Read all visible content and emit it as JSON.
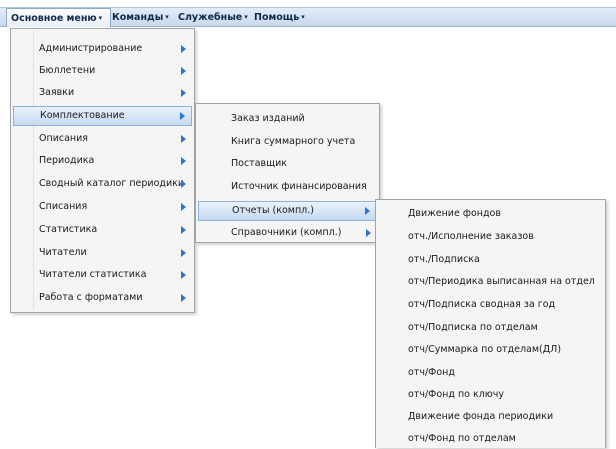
{
  "menubar": {
    "items": [
      {
        "label": "Основное меню"
      },
      {
        "label": "Команды"
      },
      {
        "label": "Служебные"
      },
      {
        "label": "Помощь"
      }
    ],
    "arrow": "▾"
  },
  "main_menu": {
    "items": [
      {
        "label": "Администрирование"
      },
      {
        "label": "Бюллетени"
      },
      {
        "label": "Заявки"
      },
      {
        "label": "Комплектование"
      },
      {
        "label": "Описания"
      },
      {
        "label": "Периодика"
      },
      {
        "label": "Сводный каталог периодики"
      },
      {
        "label": "Списания"
      },
      {
        "label": "Статистика"
      },
      {
        "label": "Читатели"
      },
      {
        "label": "Читатели статистика"
      },
      {
        "label": "Работа с форматами"
      }
    ]
  },
  "komplekt_menu": {
    "items": [
      {
        "label": "Заказ изданий"
      },
      {
        "label": "Книга суммарного учета"
      },
      {
        "label": "Поставщик"
      },
      {
        "label": "Источник финансирования"
      },
      {
        "label": "Отчеты (компл.)"
      },
      {
        "label": "Справочники (компл.)"
      }
    ]
  },
  "reports_menu": {
    "items": [
      {
        "label": "Движение фондов"
      },
      {
        "label": "отч./Исполнение заказов"
      },
      {
        "label": "отч./Подписка"
      },
      {
        "label": "отч/Периодика выписанная на отдел"
      },
      {
        "label": "отч/Подписка сводная за год"
      },
      {
        "label": "отч/Подписка по отделам"
      },
      {
        "label": "отч/Суммарка по отделам(ДЛ)"
      },
      {
        "label": "отч/Фонд"
      },
      {
        "label": "отч/Фонд по ключу"
      },
      {
        "label": "Движение фонда периодики"
      },
      {
        "label": "отч/Фонд по отделам"
      }
    ]
  },
  "colors": {
    "menubar_bg": "#c9d8ec",
    "highlight": "#c5d9f1",
    "submenu_arrow": "#2b74d6"
  }
}
